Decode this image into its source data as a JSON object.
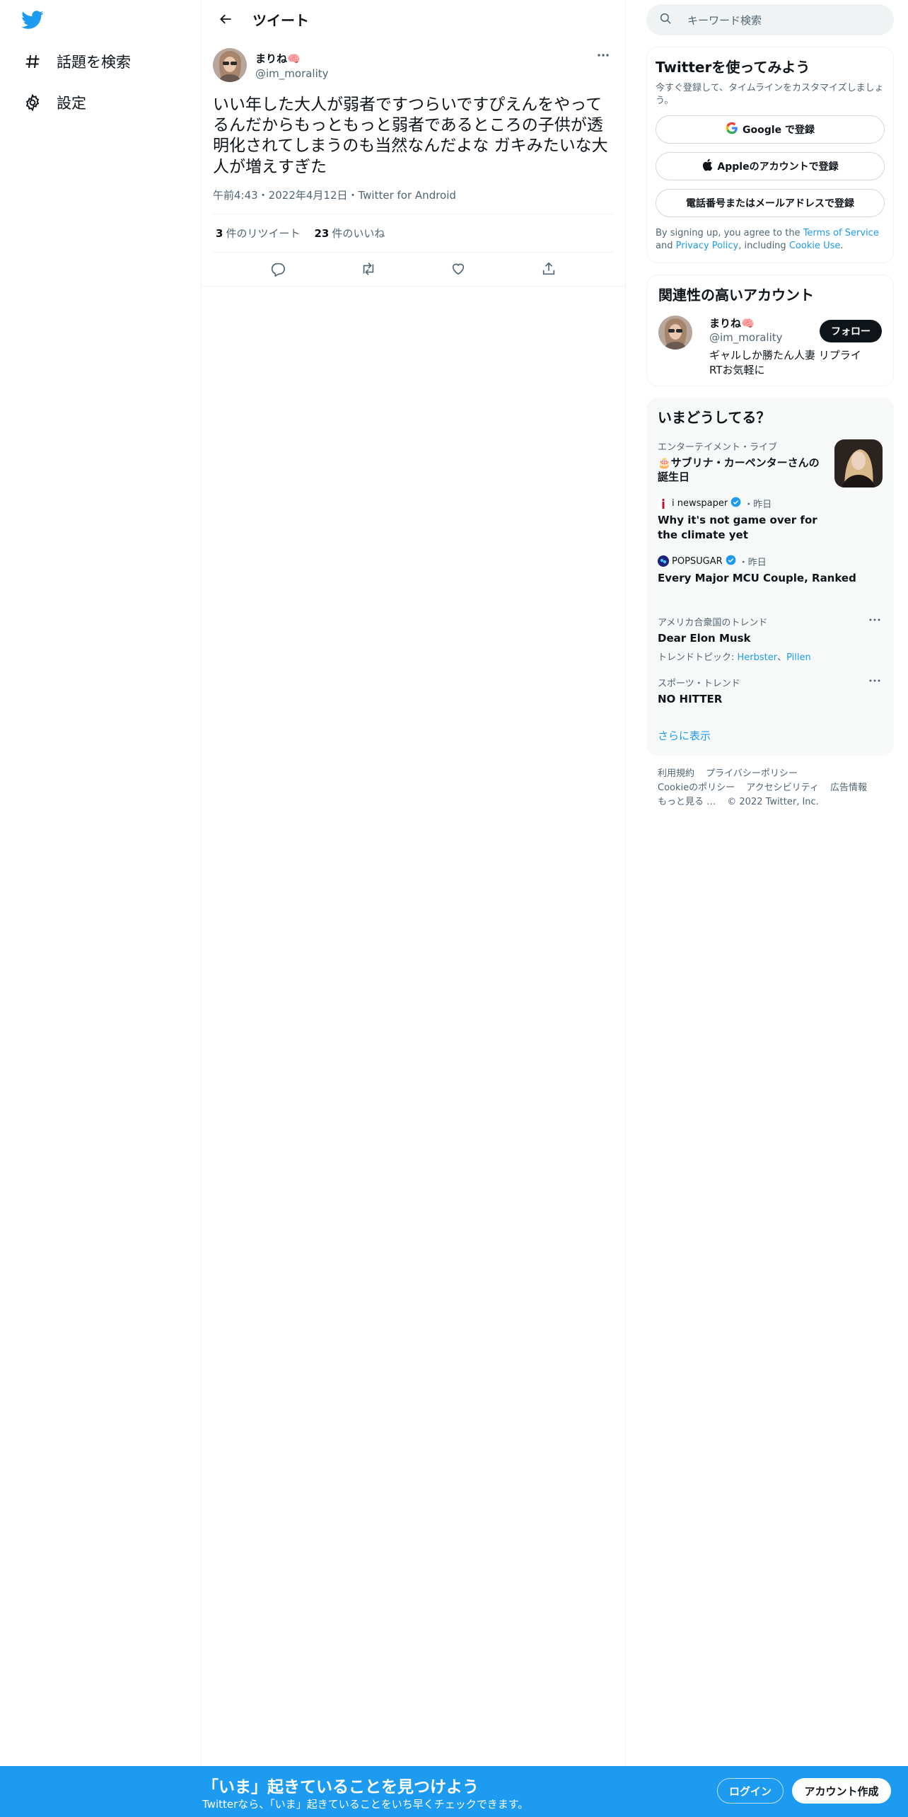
{
  "nav": {
    "logo_icon": "twitter-bird-icon",
    "items": [
      {
        "label": "話題を検索",
        "icon": "hashtag-icon"
      },
      {
        "label": "設定",
        "icon": "gear-icon"
      }
    ]
  },
  "header": {
    "title": "ツイート"
  },
  "tweet": {
    "author_name": "まりね🧠",
    "author_handle": "@im_morality",
    "text": "いい年した大人が弱者ですつらいですぴえんをやってるんだからもっともっと弱者であるところの子供が透明化されてしまうのも当然なんだよな ガキみたいな大人が増えすぎた",
    "meta": "午前4:43・2022年4月12日・Twitter for Android",
    "retweets_count": "3",
    "retweets_label": "件のリツイート",
    "likes_count": "23",
    "likes_label": "件のいいね"
  },
  "search": {
    "placeholder": "キーワード検索"
  },
  "signup_card": {
    "title": "Twitterを使ってみよう",
    "subtitle": "今すぐ登録して、タイムラインをカスタマイズしましょう。",
    "google_label": "Google で登録",
    "apple_label": "Appleのアカウントで登録",
    "phone_label": "電話番号またはメールアドレスで登録",
    "terms_prefix": "By signing up, you agree to the ",
    "terms_link": "Terms of Service",
    "terms_and": " and ",
    "privacy_link": "Privacy Policy",
    "terms_including": ", including ",
    "cookie_link": "Cookie Use",
    "terms_end": "."
  },
  "related": {
    "title": "関連性の高いアカウント",
    "name": "まりね🧠",
    "handle": "@im_morality",
    "bio": "ギャルしか勝たん人妻 リプライRTお気軽に",
    "follow_label": "フォロー"
  },
  "trends": {
    "title": "いまどうしてる？",
    "items": [
      {
        "meta": "エンターテイメント・ライブ",
        "title": "🎂サブリナ・カーペンターさんの誕生日"
      },
      {
        "source": "i newspaper",
        "time": "・昨日",
        "title": "Why it's not game over for the climate yet"
      },
      {
        "source": "POPSUGAR",
        "time": "・昨日",
        "title": "Every Major MCU Couple, Ranked"
      },
      {
        "meta": "アメリカ合衆国のトレンド",
        "title": "Dear Elon Musk",
        "sub_prefix": "トレンドトピック: ",
        "sub_link1": "Herbster",
        "sub_sep": "、",
        "sub_link2": "Pillen"
      },
      {
        "meta": "スポーツ・トレンド",
        "title": "NO HITTER"
      }
    ],
    "show_more": "さらに表示"
  },
  "footer": {
    "links": [
      "利用規約",
      "プライバシーポリシー",
      "Cookieのポリシー",
      "アクセシビリティ",
      "広告情報",
      "もっと見る …",
      "© 2022 Twitter, Inc."
    ]
  },
  "bottom_bar": {
    "title": "「いま」起きていることを見つけよう",
    "subtitle": "Twitterなら、「いま」起きていることをいち早くチェックできます。",
    "login_label": "ログイン",
    "signup_label": "アカウント作成"
  },
  "colors": {
    "accent": "#1d9bf0",
    "text": "#0f1419",
    "secondary": "#536471"
  }
}
